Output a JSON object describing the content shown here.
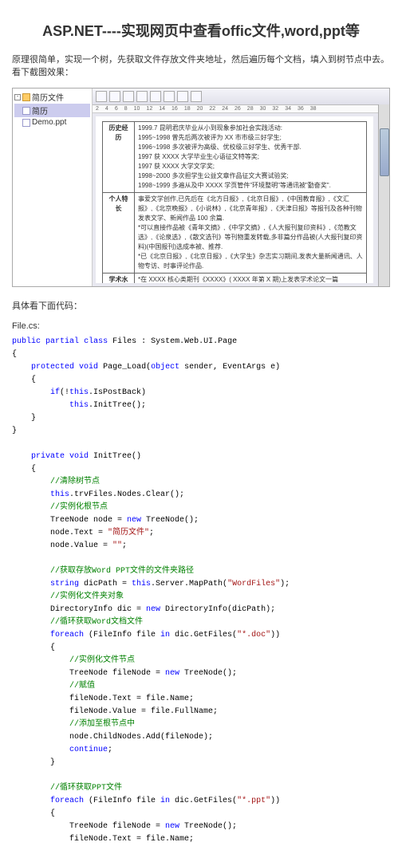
{
  "title": "ASP.NET----实现网页中查看offic文件,word,ppt等",
  "intro": "原理很简单，实现一个树，先获取文件存放文件夹地址，然后遍历每个文档，填入到树节点中去。看下截图效果：",
  "tree": {
    "root": "简历文件",
    "item1": "简历",
    "item2": "Demo.ppt"
  },
  "ruler": [
    "2",
    "4",
    "6",
    "8",
    "10",
    "12",
    "14",
    "16",
    "18",
    "20",
    "22",
    "24",
    "26",
    "28",
    "30",
    "32",
    "34",
    "36",
    "38"
  ],
  "doc": {
    "r1_lbl": "历史经历",
    "r1_txt": "1999.7 昆明君庆毕业从小到现象参加社会实践活动:\n1995~1998 曾先后两次被评为 XX 市市级三好学生;\n1996~1998 多次被评为高级、优校级三好学生、优秀干部.\n1997 获 XXXX 大学毕业生心语征文特等奖;\n1997 获 XXXX 大学文学奖;\n1998~2000 多次担学生公益文章作品征文大赛试验奖;\n1998~1999 多遍从及中 XXXX 学页管件\"环境整明\"等通讯被\"勤奋奖\".",
    "r2_lbl": "个人特长",
    "r2_txt": "事爱文学创作,已先后在《北方日报》,《北京日报》,《中国教育报》,《文汇报》,《北京晚报》,《小说林》,《北京青年报》,《天津日报》等报刊及各种刊物发表文学、新闻作品 100 余篇.\n*可以直接作品被《青年文摘》,《中学文摘》,《人大报刊复印资料》,《范教文选》,《论泉选》,《散文选刊》等刊物重发转载,多非篇分作品被(人大报刊复印资料)(中国报刊)选成本被、推荐.\n*已《北京日报》,《北京日报》,《大学生》杂志实习期间,发表大量新闻通讯、人物专访、时事评论作品.",
    "r3_lbl": "学术水平",
    "r3_txt": "*在 XXXX 核心类期刊《XXXX》( XXXX 年第 X 期)上发表学术论文一篇"
  },
  "subhead1": "具体看下面代码：",
  "subhead2": "File.cs:",
  "code": {
    "l01a": "public",
    "l01b": "partial",
    "l01c": "class",
    "l01d": "Files : System.Web.UI.Page",
    "l02": "{",
    "l03a": "    protected",
    "l03b": "void",
    "l03c": "Page_Load(",
    "l03d": "object",
    "l03e": " sender, EventArgs e)",
    "l04": "    {",
    "l05a": "        if",
    "l05b": "(!",
    "l05c": "this",
    "l05d": ".IsPostBack)",
    "l06a": "            this",
    "l06b": ".InitTree();",
    "l07": "    }",
    "l08": "}",
    "l10a": "    private",
    "l10b": "void",
    "l10c": " InitTree()",
    "l11": "    {",
    "l12": "        //清除树节点",
    "l13a": "        this",
    "l13b": ".trvFiles.Nodes.Clear();",
    "l14": "        //实例化根节点",
    "l15a": "        TreeNode node = ",
    "l15b": "new",
    "l15c": " TreeNode();",
    "l16a": "        node.Text = ",
    "l16b": "\"简历文件\"",
    "l16c": ";",
    "l17a": "        node.Value = ",
    "l17b": "\"\"",
    "l17c": ";",
    "l19": "        //获取存放Word PPT文件的文件夹路径",
    "l20a": "        string",
    "l20b": " dicPath = ",
    "l20c": "this",
    "l20d": ".Server.MapPath(",
    "l20e": "\"WordFiles\"",
    "l20f": ");",
    "l21": "        //实例化文件夹对象",
    "l22a": "        DirectoryInfo dic = ",
    "l22b": "new",
    "l22c": " DirectoryInfo(dicPath);",
    "l23": "        //循环获取Word文档文件",
    "l24a": "        foreach",
    "l24b": " (FileInfo file ",
    "l24c": "in",
    "l24d": " dic.GetFiles(",
    "l24e": "\"*.doc\"",
    "l24f": "))",
    "l25": "        {",
    "l26": "            //实例化文件节点",
    "l27a": "            TreeNode fileNode = ",
    "l27b": "new",
    "l27c": " TreeNode();",
    "l28": "            //赋值",
    "l29": "            fileNode.Text = file.Name;",
    "l30": "            fileNode.Value = file.FullName;",
    "l31": "            //添加至根节点中",
    "l32": "            node.ChildNodes.Add(fileNode);",
    "l33a": "            continue",
    "l33b": ";",
    "l34": "        }",
    "l36": "        //循环获取PPT文件",
    "l37a": "        foreach",
    "l37b": " (FileInfo file ",
    "l37c": "in",
    "l37d": " dic.GetFiles(",
    "l37e": "\"*.ppt\"",
    "l37f": "))",
    "l38": "        {",
    "l39a": "            TreeNode fileNode = ",
    "l39b": "new",
    "l39c": " TreeNode();",
    "l40": "            fileNode.Text = file.Name;"
  }
}
